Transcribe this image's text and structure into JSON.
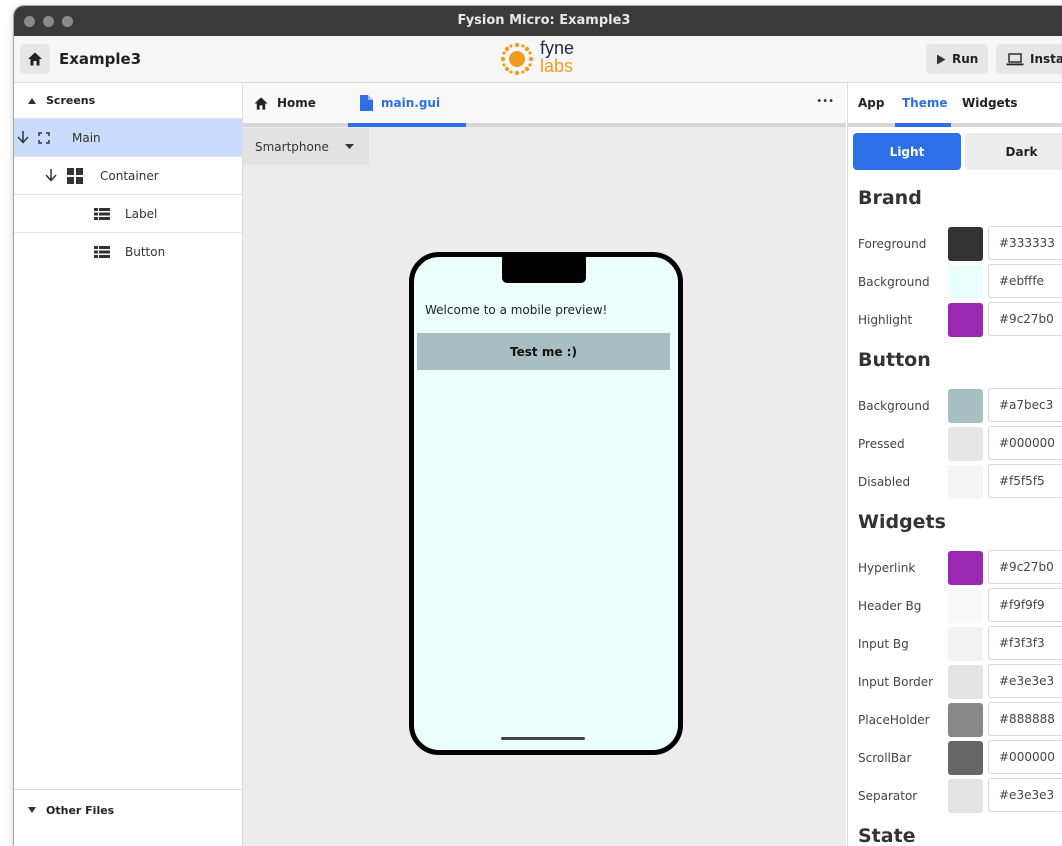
{
  "window": {
    "title": "Fysion Micro: Example3"
  },
  "toolbar": {
    "project_title": "Example3",
    "logo_text": [
      "fyne",
      "labs"
    ],
    "run_label": "Run",
    "install_label": "Install"
  },
  "screens_panel": {
    "header": "Screens",
    "items": [
      {
        "label": "Main"
      },
      {
        "label": "Container"
      },
      {
        "label": "Label"
      },
      {
        "label": "Button"
      }
    ],
    "other_files": "Other Files"
  },
  "editor": {
    "tabs": [
      {
        "label": "Home"
      },
      {
        "label": "main.gui"
      }
    ],
    "more": "•••",
    "device": "Smartphone"
  },
  "preview": {
    "welcome_text": "Welcome to a mobile preview!",
    "button_text": "Test me :)"
  },
  "theme_panel": {
    "tabs": [
      "App",
      "Theme",
      "Widgets"
    ],
    "modes": [
      "Light",
      "Dark"
    ],
    "sections": [
      {
        "title": "Brand",
        "rows": [
          {
            "label": "Foreground",
            "hex": "#333333",
            "swatch": "#333333"
          },
          {
            "label": "Background",
            "hex": "#ebfffe",
            "swatch": "#ebfffe"
          },
          {
            "label": "Highlight",
            "hex": "#9c27b0",
            "swatch": "#9c27b0"
          }
        ]
      },
      {
        "title": "Button",
        "rows": [
          {
            "label": "Background",
            "hex": "#a7bec3",
            "swatch": "#a7bec3"
          },
          {
            "label": "Pressed",
            "hex": "#000000",
            "swatch": "#e6e6e6"
          },
          {
            "label": "Disabled",
            "hex": "#f5f5f5",
            "swatch": "#f5f5f5"
          }
        ]
      },
      {
        "title": "Widgets",
        "rows": [
          {
            "label": "Hyperlink",
            "hex": "#9c27b0",
            "swatch": "#9c27b0"
          },
          {
            "label": "Header Bg",
            "hex": "#f9f9f9",
            "swatch": "#f9f9f9"
          },
          {
            "label": "Input Bg",
            "hex": "#f3f3f3",
            "swatch": "#f3f3f3"
          },
          {
            "label": "Input Border",
            "hex": "#e3e3e3",
            "swatch": "#e3e3e3"
          },
          {
            "label": "PlaceHolder",
            "hex": "#888888",
            "swatch": "#888888"
          },
          {
            "label": "ScrollBar",
            "hex": "#000000",
            "swatch": "#666666"
          },
          {
            "label": "Separator",
            "hex": "#e3e3e3",
            "swatch": "#e3e3e3"
          }
        ]
      },
      {
        "title": "State",
        "rows": []
      }
    ]
  },
  "colors": {
    "accent": "#2e6fe8",
    "selection": "#c9dcfb",
    "logo_orange": "#f29c1f"
  }
}
